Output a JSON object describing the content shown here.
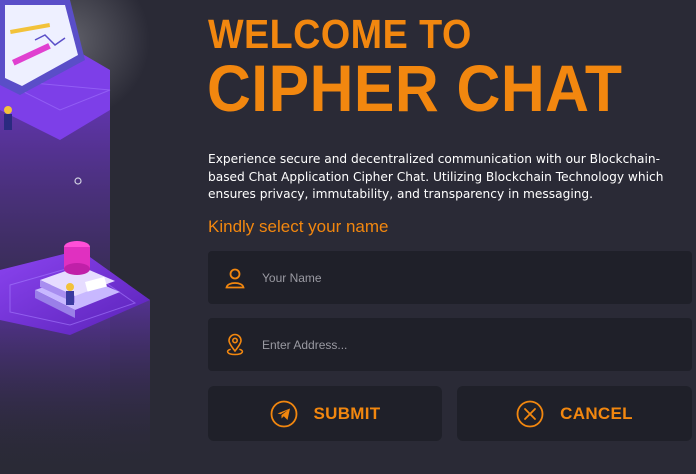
{
  "welcome": {
    "line1": "WELCOME TO",
    "line2": "CIPHER CHAT"
  },
  "description": "Experience secure and decentralized communication with our Blockchain-based Chat Application Cipher Chat. Utilizing Blockchain Technology which ensures privacy, immutability, and transparency in messaging.",
  "form": {
    "prompt": "Kindly select your name",
    "name_field": {
      "placeholder": "Your Name",
      "value": "",
      "icon": "user-icon"
    },
    "address_field": {
      "placeholder": "Enter Address...",
      "value": "",
      "icon": "location-pin-icon"
    }
  },
  "buttons": {
    "submit": {
      "label": "SUBMIT",
      "icon": "send-icon"
    },
    "cancel": {
      "label": "CANCEL",
      "icon": "close-circle-icon"
    }
  },
  "colors": {
    "accent": "#f2870f",
    "background": "#2a2a36",
    "field_background": "#1f2029",
    "illustration_purple": "#6a2ed0"
  }
}
